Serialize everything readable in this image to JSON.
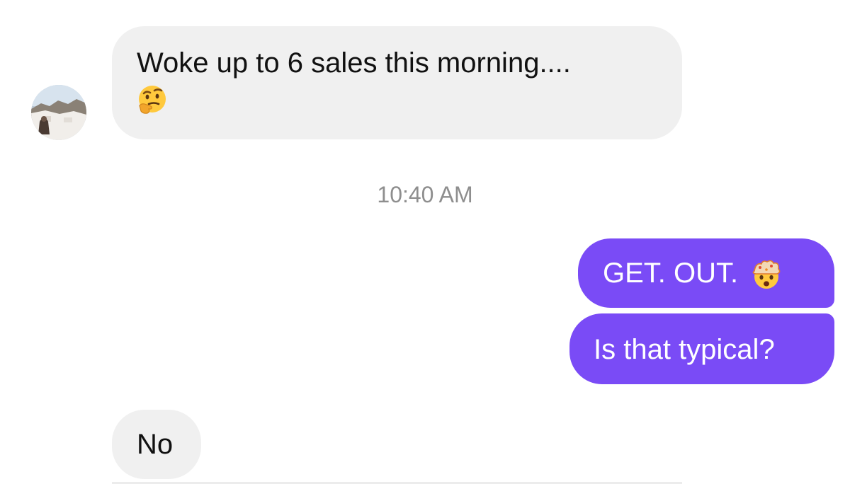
{
  "messages": [
    {
      "sender": "other",
      "text_line1": "Woke up to 6 sales this morning....",
      "emoji": "thinking-face-emoji"
    },
    {
      "sender": "self",
      "text": "GET. OUT.",
      "emoji": "exploding-head-emoji"
    },
    {
      "sender": "self",
      "text": "Is that typical?"
    },
    {
      "sender": "other",
      "text": "No"
    }
  ],
  "timestamp": "10:40 AM",
  "colors": {
    "incoming_bubble": "#f0f0f0",
    "outgoing_bubble": "#7a4bf6",
    "timestamp_text": "#8e8e8e",
    "background": "#ffffff"
  }
}
